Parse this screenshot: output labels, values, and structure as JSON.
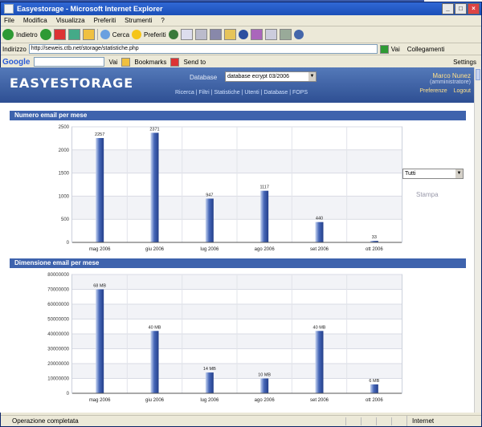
{
  "window": {
    "title": "Easyestorage - Microsoft Internet Explorer",
    "menu": [
      "File",
      "Modifica",
      "Visualizza",
      "Preferiti",
      "Strumenti",
      "?"
    ],
    "toolbar": {
      "back": "Indietro",
      "search": "Cerca",
      "favorites": "Preferiti"
    },
    "address": {
      "label": "Indirizzo",
      "url": "http://seweis.ctb.net/storage/statistiche.php",
      "go": "Vai",
      "links": "Collegamenti"
    },
    "google": {
      "logo": "Google",
      "go": "Vai",
      "bookmarks": "Bookmarks",
      "sendto": "Send to",
      "settings": "Settings"
    },
    "status": {
      "text": "Operazione completata",
      "zone": "Internet"
    }
  },
  "app": {
    "logo": "EASYESTORAGE",
    "database_label": "Database",
    "database_value": "database ecrypt 03/2006",
    "nav": "Ricerca | Filtri | Statistiche | Utenti | Database | FOPS",
    "user_name": "Marco Nunez",
    "user_role": "(amministratore)",
    "preferences": "Preferenze",
    "logout": "Logout"
  },
  "side": {
    "select_value": "Tutti",
    "button": "Stampa"
  },
  "charts": [
    {
      "heading": "Numero email per mese"
    },
    {
      "heading": "Dimensione email per mese"
    }
  ],
  "chart_data": [
    {
      "type": "bar",
      "title": "Numero email per mese",
      "categories": [
        "mag 2006",
        "giu 2006",
        "lug 2006",
        "ago 2006",
        "set 2006",
        "ott 2006"
      ],
      "values": [
        2257,
        2371,
        947,
        1117,
        440,
        33
      ],
      "labels": [
        "2257",
        "2371",
        "947",
        "1117",
        "440",
        "33"
      ],
      "ylim": [
        0,
        2500
      ],
      "yticks": [
        0,
        500,
        1000,
        1500,
        2000,
        2500
      ],
      "yticklabels": [
        "0",
        "500",
        "1000",
        "1500",
        "2000",
        "2500"
      ],
      "grid": true
    },
    {
      "type": "bar",
      "title": "Dimensione email per mese",
      "categories": [
        "mag 2006",
        "giu 2006",
        "lug 2006",
        "ago 2006",
        "set 2006",
        "ott 2006"
      ],
      "values": [
        70000000,
        42000000,
        14000000,
        10000000,
        42000000,
        6000000
      ],
      "labels": [
        "68 MB",
        "40 MB",
        "14 MB",
        "10 MB",
        "40 MB",
        "6 MB"
      ],
      "ylim": [
        0,
        80000000
      ],
      "yticks": [
        0,
        10000000,
        20000000,
        30000000,
        40000000,
        50000000,
        60000000,
        70000000,
        80000000
      ],
      "yticklabels": [
        "0",
        "10000000",
        "20000000",
        "30000000",
        "40000000",
        "50000000",
        "60000000",
        "70000000",
        "80000000"
      ],
      "grid": true
    }
  ]
}
